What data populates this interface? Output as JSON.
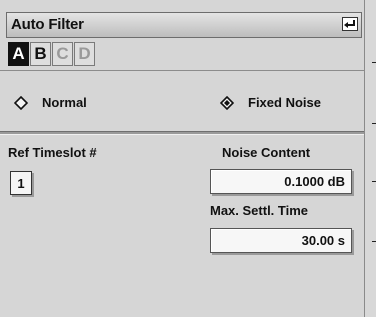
{
  "title": "Auto Filter",
  "tabs": [
    "A",
    "B",
    "C",
    "D"
  ],
  "active_tab": "A",
  "mode_options": [
    {
      "label": "Normal",
      "selected": false
    },
    {
      "label": "Fixed Noise",
      "selected": true
    }
  ],
  "ref_timeslot": {
    "label": "Ref Timeslot #",
    "value": "1"
  },
  "noise_content": {
    "label": "Noise Content",
    "value": "0.1000 dB"
  },
  "max_settl_time": {
    "label": "Max. Settl. Time",
    "value": "30.00 s"
  }
}
